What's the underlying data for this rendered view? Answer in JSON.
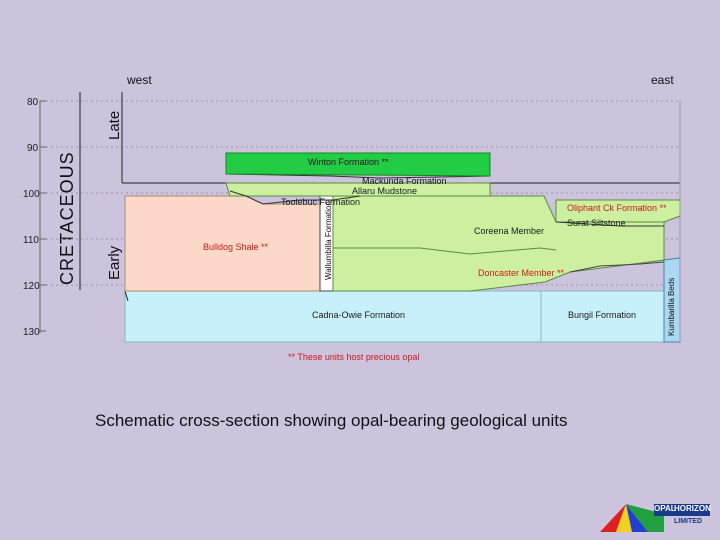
{
  "directions": {
    "west": "west",
    "east": "east"
  },
  "period": "CRETACEOUS",
  "epochs": {
    "late": "Late",
    "early": "Early"
  },
  "age_ticks": [
    "80",
    "90",
    "100",
    "110",
    "120",
    "130"
  ],
  "units": {
    "winton": "Winton Formation **",
    "mackunda": "Mackunda Formation",
    "allaru": "Allaru Mudstone",
    "toolebuc": "Toolebuc Formation",
    "wallumbilla": "Wallumbilla Formation",
    "oliphant": "Oliphant Ck Formation **",
    "coreena": "Coreena Member",
    "surat": "Surat Siltstone",
    "bulldog": "Bulldog Shale **",
    "doncaster": "Doncaster Member **",
    "cadna_owie": "Cadna-Owie Formation",
    "bungil": "Bungil Formation",
    "kumbarilla": "Kumbarilla Beds"
  },
  "note": "** These units host precious opal",
  "caption": "Schematic cross-section showing opal-bearing geological units",
  "logo": {
    "brand1": "OPAL",
    "brand2": "HORIZON",
    "brand3": "LIMITED"
  },
  "colors": {
    "background": "#ccc3dc",
    "winton": "#22cc44",
    "light_green": "#ccf0a0",
    "wallumbilla": "#ffffff",
    "bulldog": "#fcd8c8",
    "cadna_owie": "#c8f0fa",
    "kumbarilla": "#a8d8f4"
  }
}
